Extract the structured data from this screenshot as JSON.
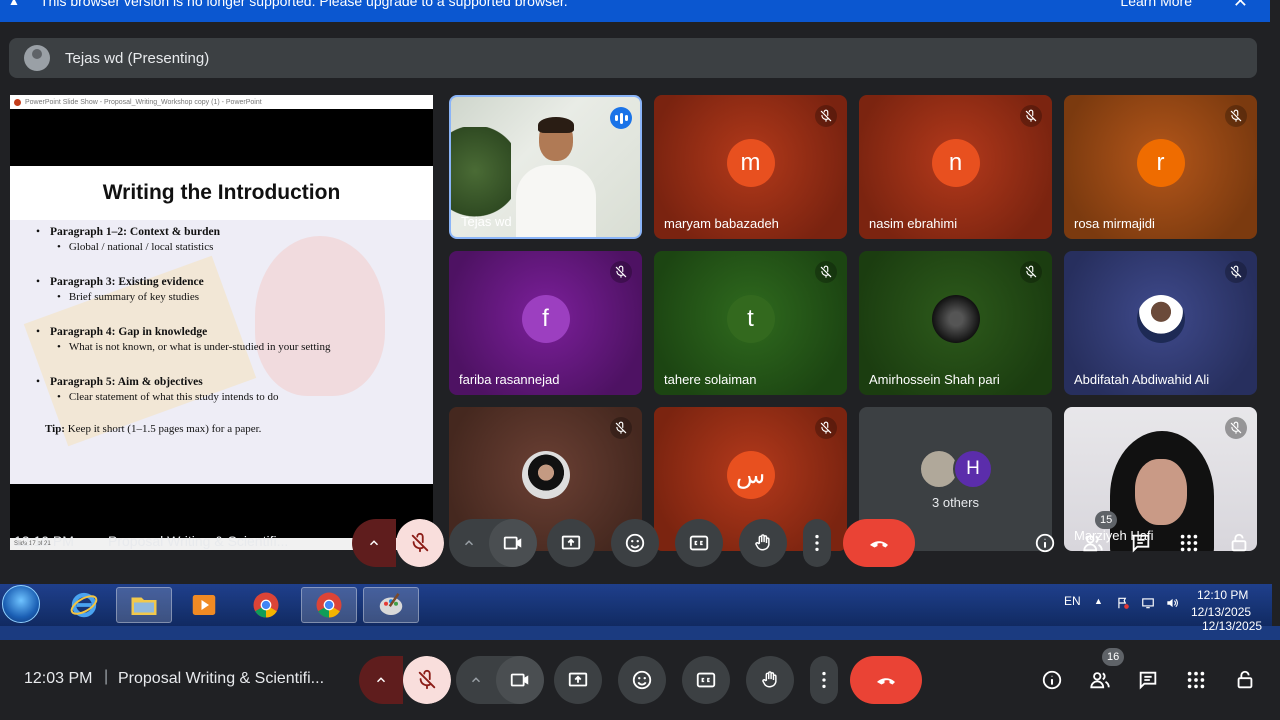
{
  "banner": {
    "text": "This browser version is no longer supported. Please upgrade to a supported browser.",
    "learn_more": "Learn More",
    "close": "✕"
  },
  "presenter": {
    "label": "Tejas wd (Presenting)"
  },
  "slide": {
    "window_title": "PowerPoint Slide Show  -  Proposal_Writing_Workshop copy (1)  -  PowerPoint",
    "title": "Writing the Introduction",
    "items": [
      {
        "heading": "Paragraph 1–2: Context & burden",
        "sub": "Global / national / local statistics"
      },
      {
        "heading": "Paragraph 3: Existing evidence",
        "sub": "Brief summary of key studies"
      },
      {
        "heading": "Paragraph 4: Gap in knowledge",
        "sub": "What is not known, or what is under-studied in your setting"
      },
      {
        "heading": "Paragraph 5: Aim & objectives",
        "sub": "Clear statement of what this study intends to do"
      }
    ],
    "tip_label": "Tip:",
    "tip_text": " Keep it short (1–1.5 pages max) for a paper.",
    "footer": "Slide 17 of 21"
  },
  "inner_meeting": {
    "time": "12:10 PM",
    "title": "Proposal Writing & Scientifi..."
  },
  "participants": [
    {
      "name": "Tejas wd"
    },
    {
      "name": "maryam babazadeh",
      "initial": "m",
      "color": "#e8501f"
    },
    {
      "name": "nasim ebrahimi",
      "initial": "n",
      "color": "#e8501f"
    },
    {
      "name": "rosa mirmajidi",
      "initial": "r",
      "color": "#ef6c00"
    },
    {
      "name": "fariba rasannejad",
      "initial": "f",
      "color": "#9c3fc0"
    },
    {
      "name": "tahere solaiman",
      "initial": "t",
      "color": "#33691e"
    },
    {
      "name": "Amirhossein Shah pari"
    },
    {
      "name": "Abdifatah Abdiwahid Ali"
    },
    {
      "name": ""
    },
    {
      "name": "",
      "initial": "س",
      "color": "#e8501f"
    },
    {
      "name": "3 others",
      "initial": "H"
    },
    {
      "name": "Marziyeh Hafi"
    }
  ],
  "inner_people_count": "15",
  "people_count": "16",
  "meeting": {
    "time": "12:03 PM",
    "separator": "|",
    "title": "Proposal Writing & Scientifi..."
  },
  "taskbar": {
    "lang": "EN",
    "time": "12:10 PM",
    "date": "12/13/2025",
    "date_echo": "12/13/2025"
  }
}
